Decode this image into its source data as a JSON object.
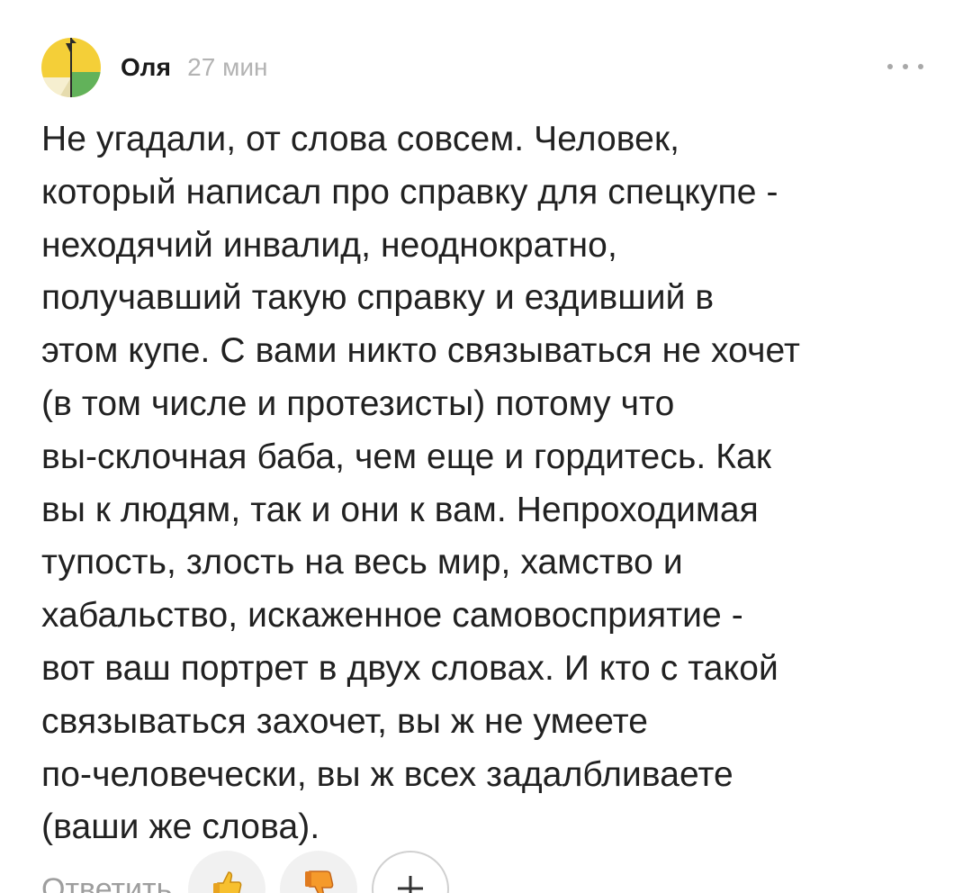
{
  "comment": {
    "author": "Оля",
    "time": "27 мин",
    "text": "Не угадали, от слова совсем. Человек,\nкоторый написал про справку для спецкупе -\nнеходячий инвалид, неоднократно,\nполучавший такую справку и ездивший в\nэтом купе. С вами никто связываться не хочет\n(в том числе и протезисты) потому что\nвы-склочная баба, чем еще и гордитесь. Как\nвы к людям, так и они к вам. Непроходимая\nтупость, злость на весь мир, хамство и\nхабальство, искаженное самовосприятие -\nвот ваш портрет в двух словах. И кто с такой\nсвязываться захочет, вы ж не умеете\nпо-человечески, вы ж всех задалбливаете\n(ваши же слова).",
    "reply_label": "Ответить",
    "more_icon": "more-horizontal-icon",
    "reactions": [
      {
        "icon": "thumbs-up-icon"
      },
      {
        "icon": "thumbs-down-icon"
      }
    ],
    "add_reaction_icon": "plus-icon"
  },
  "colors": {
    "avatar_yellow": "#f4cf38",
    "avatar_green": "#62b25a",
    "avatar_cream": "#f6efd0",
    "time_gray": "#b3b3b3",
    "text": "#212121"
  }
}
